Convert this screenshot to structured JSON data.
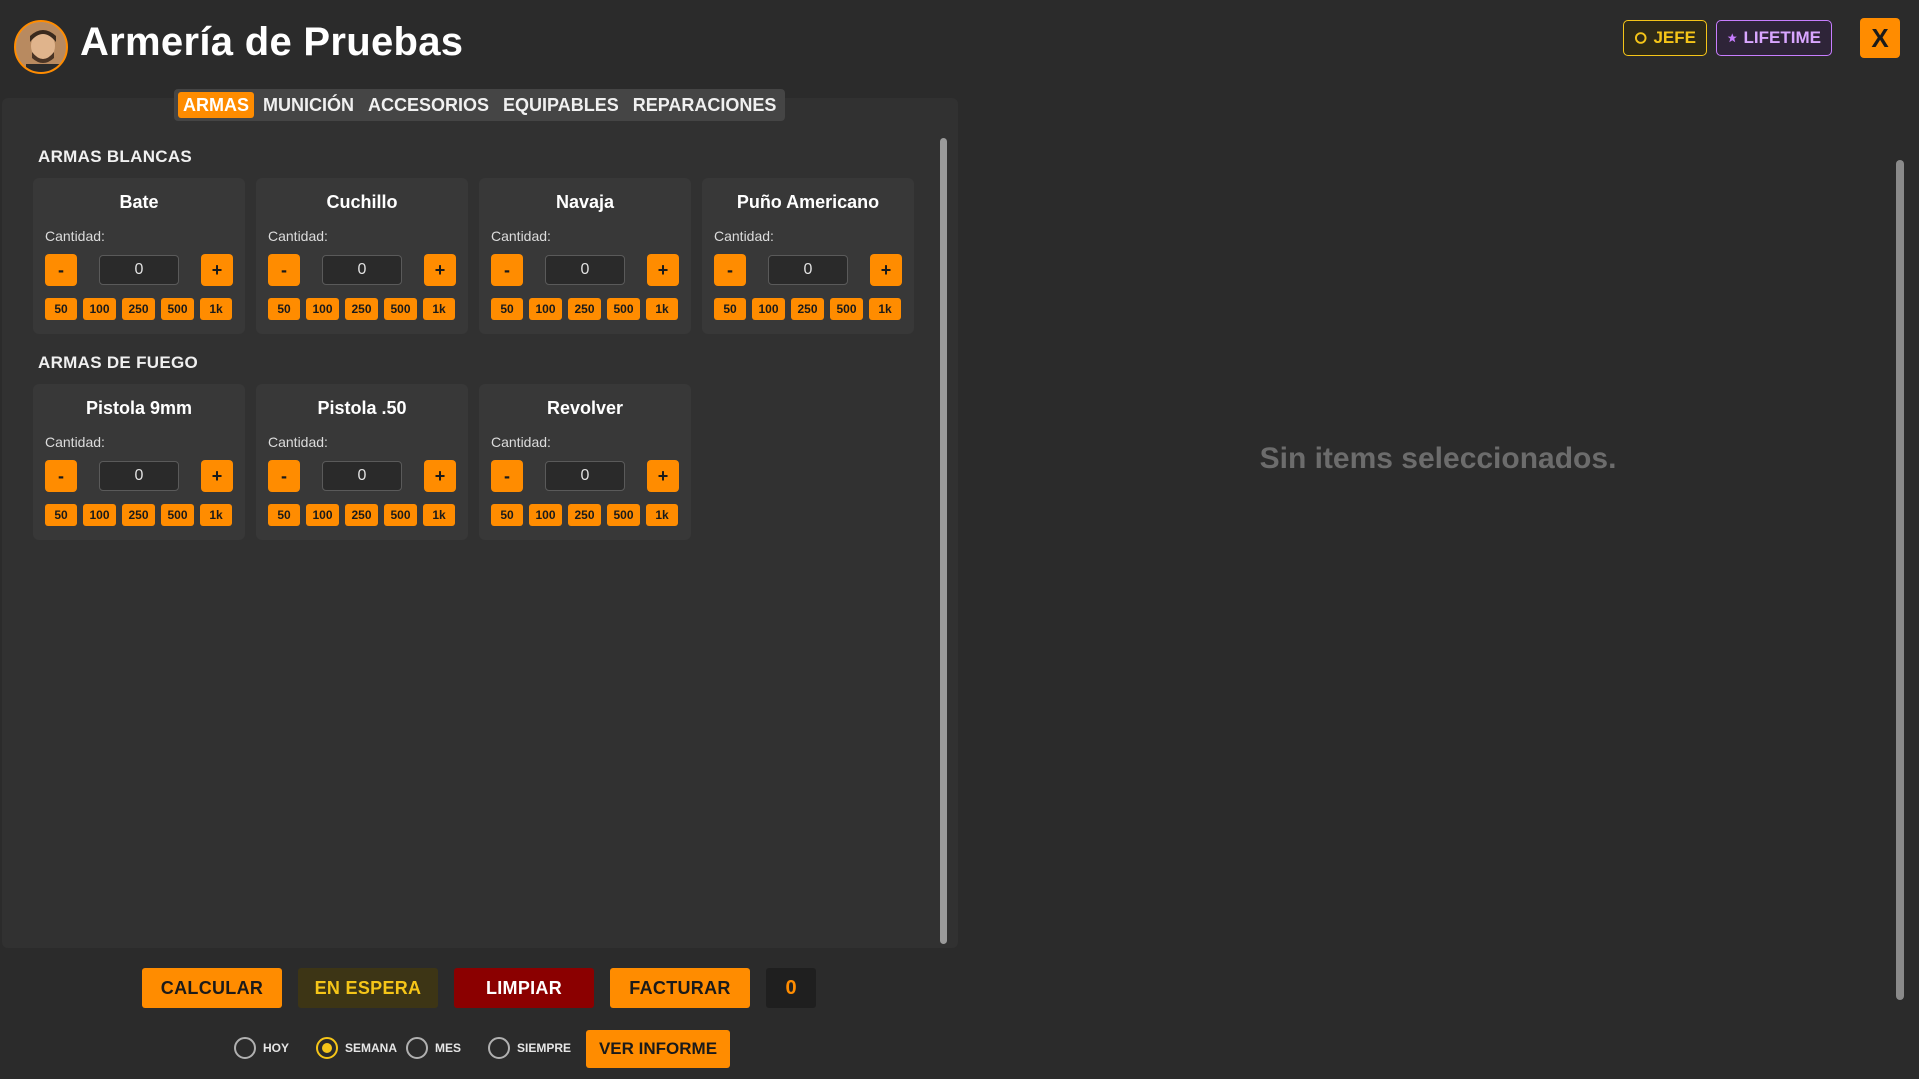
{
  "header": {
    "title": "Armería de Pruebas",
    "badges": {
      "jefe": "JEFE",
      "lifetime": "LIFETIME"
    },
    "close_label": "X"
  },
  "tabs": [
    {
      "label": "ARMAS",
      "active": true
    },
    {
      "label": "MUNICIÓN",
      "active": false
    },
    {
      "label": "ACCESORIOS",
      "active": false
    },
    {
      "label": "EQUIPABLES",
      "active": false
    },
    {
      "label": "REPARACIONES",
      "active": false
    }
  ],
  "sections": [
    {
      "title": "ARMAS BLANCAS",
      "items": [
        {
          "name": "Bate",
          "qty_label": "Cantidad:",
          "qty": "0"
        },
        {
          "name": "Cuchillo",
          "qty_label": "Cantidad:",
          "qty": "0"
        },
        {
          "name": "Navaja",
          "qty_label": "Cantidad:",
          "qty": "0"
        },
        {
          "name": "Puño Americano",
          "qty_label": "Cantidad:",
          "qty": "0"
        }
      ]
    },
    {
      "title": "ARMAS DE FUEGO",
      "items": [
        {
          "name": "Pistola 9mm",
          "qty_label": "Cantidad:",
          "qty": "0"
        },
        {
          "name": "Pistola .50",
          "qty_label": "Cantidad:",
          "qty": "0"
        },
        {
          "name": "Revolver",
          "qty_label": "Cantidad:",
          "qty": "0"
        }
      ]
    }
  ],
  "stepper": {
    "minus": "-",
    "plus": "+"
  },
  "quick_amounts": [
    "50",
    "100",
    "250",
    "500",
    "1k"
  ],
  "right_panel": {
    "empty_message": "Sin items seleccionados."
  },
  "footer": {
    "calcular": "CALCULAR",
    "en_espera": "EN ESPERA",
    "limpiar": "LIMPIAR",
    "facturar": "FACTURAR",
    "total": "0",
    "periods": [
      {
        "label": "HOY",
        "checked": false
      },
      {
        "label": "SEMANA",
        "checked": true
      },
      {
        "label": "MES",
        "checked": false
      },
      {
        "label": "SIEMPRE",
        "checked": false
      }
    ],
    "ver_informe": "VER INFORME"
  },
  "colors": {
    "accent": "#ff8c00",
    "gold": "#f5c518",
    "purple": "#c77dff",
    "danger": "#8b0000"
  }
}
